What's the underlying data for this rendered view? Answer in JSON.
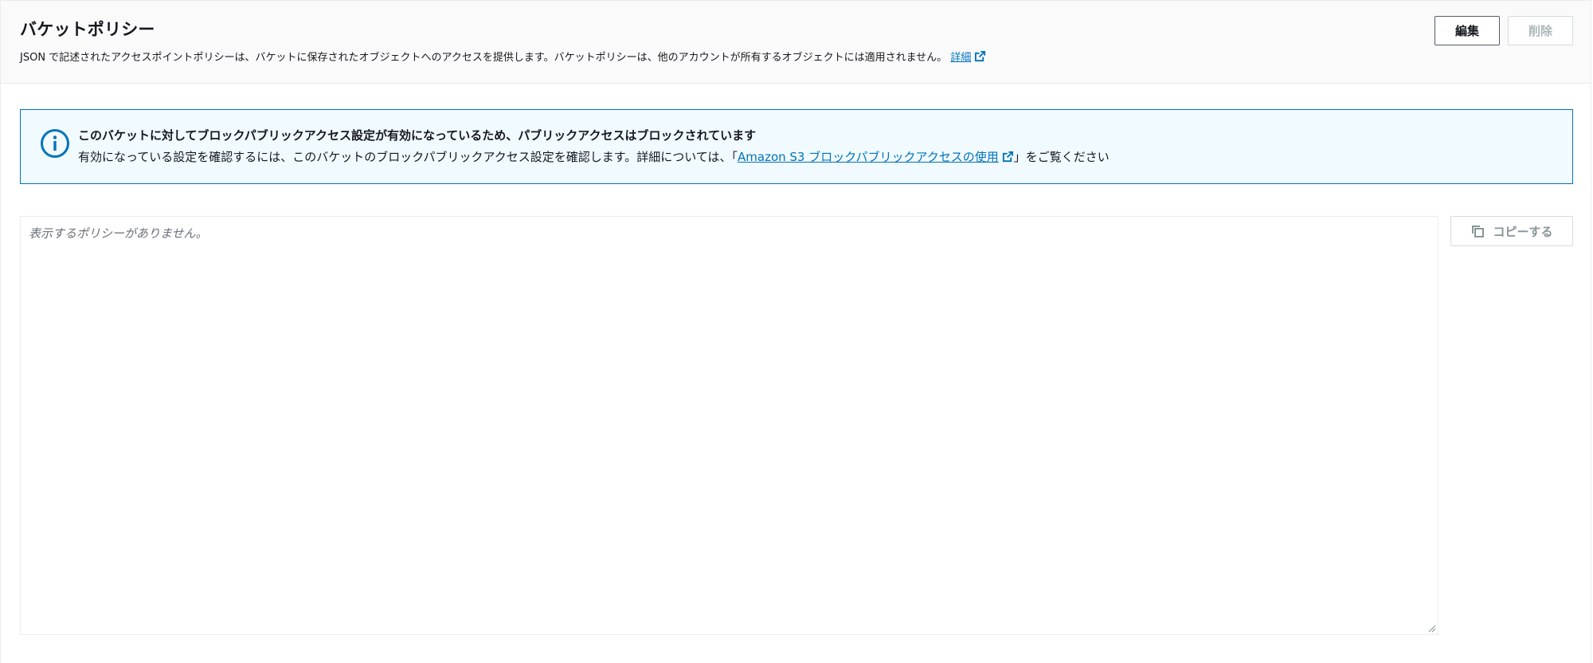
{
  "header": {
    "title": "バケットポリシー",
    "description": "JSON で記述されたアクセスポイントポリシーは、バケットに保存されたオブジェクトへのアクセスを提供します。バケットポリシーは、他のアカウントが所有するオブジェクトには適用されません。",
    "info_link": "詳細",
    "edit_label": "編集",
    "delete_label": "削除"
  },
  "alert": {
    "icon": "info-icon",
    "title": "このバケットに対してブロックパブリックアクセス設定が有効になっているため、パブリックアクセスはブロックされています",
    "body_prefix": "有効になっている設定を確認するには、このバケットのブロックパブリックアクセス設定を確認します。詳細については、「",
    "link_text": "Amazon S3 ブロックパブリックアクセスの使用",
    "body_suffix": "」をご覧ください"
  },
  "editor": {
    "placeholder": "表示するポリシーがありません。"
  },
  "copy_button": {
    "icon": "copy-icon",
    "label": "コピーする"
  },
  "colors": {
    "link": "#0073bb",
    "alert_bg": "#f1faff",
    "alert_border": "#0073bb",
    "header_bg": "#fafafa",
    "disabled_text": "#aab7b8"
  }
}
